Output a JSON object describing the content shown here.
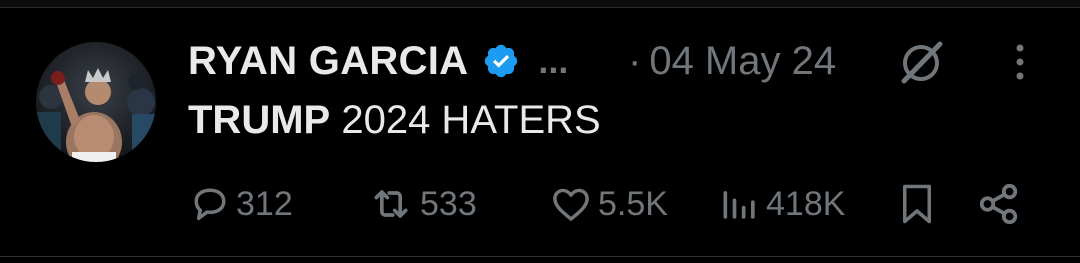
{
  "tweet": {
    "author_name": "RYAN GARCIA",
    "handle_truncated": "...",
    "date_separator": "·",
    "date": "04 May 24",
    "text_bold": "TRUMP",
    "text_rest": " 2024 HATERS"
  },
  "actions": {
    "replies": "312",
    "reposts": "533",
    "likes": "5.5K",
    "views": "418K"
  },
  "icons": {
    "verified": "verified-badge-icon",
    "grok": "grok-icon",
    "more": "more-vertical-icon",
    "reply": "reply-icon",
    "repost": "repost-icon",
    "like": "heart-icon",
    "views": "views-icon",
    "bookmark": "bookmark-icon",
    "share": "share-icon"
  },
  "colors": {
    "background": "#000000",
    "text_primary": "#e7e9ea",
    "text_secondary": "#71767b",
    "verified_blue": "#1d9bf0"
  }
}
